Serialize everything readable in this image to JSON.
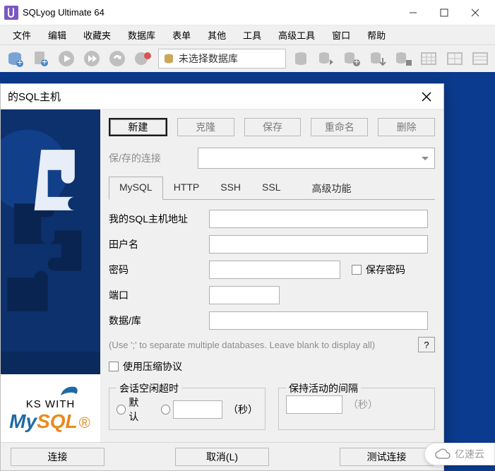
{
  "app": {
    "title": "SQLyog Ultimate 64"
  },
  "menu": {
    "file": "文件",
    "edit": "编辑",
    "favorite": "收藏夹",
    "database": "数据库",
    "table": "表单",
    "other": "其他",
    "tools": "工具",
    "advtools": "高级工具",
    "window": "窗口",
    "help": "帮助"
  },
  "toolbar": {
    "db_placeholder": "未选择数据库"
  },
  "dialog": {
    "title": "的SQL主机",
    "buttons": {
      "new": "新建",
      "clone": "克隆",
      "save": "保存",
      "rename": "重命名",
      "delete": "删除"
    },
    "saved_label": "保/存的连接",
    "tabs": {
      "mysql": "MySQL",
      "http": "HTTP",
      "ssh": "SSH",
      "ssl": "SSL",
      "adv": "高级功能"
    },
    "fields": {
      "host": "我的SQL主机地址",
      "user": "田户名",
      "password": "密码",
      "save_password": "保存密码",
      "port": "端口",
      "database": "数据/库",
      "hint": "(Use ';' to separate multiple databases. Leave blank to display all)",
      "help": "?",
      "compress": "使用压缩协议"
    },
    "idle": {
      "legend": "会话空闲超时",
      "default": "默认",
      "unit": "（秒）"
    },
    "keepalive": {
      "legend": "保持活动的间隔",
      "unit": "（秒）"
    },
    "footer": {
      "connect": "连接",
      "cancel": "取消(L)",
      "test": "测试连接"
    }
  },
  "watermark": "亿速云"
}
